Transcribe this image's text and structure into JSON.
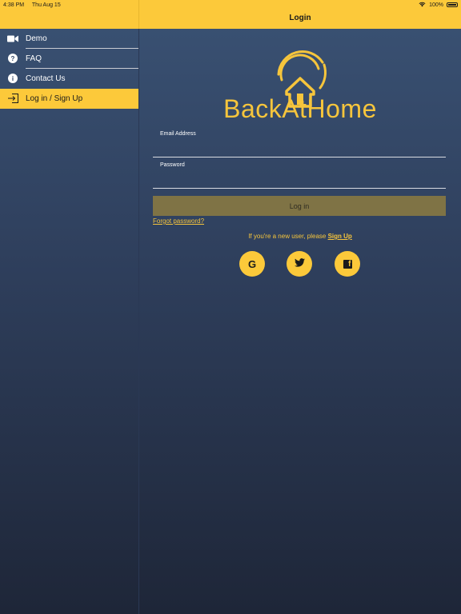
{
  "status_bar": {
    "time": "4:38 PM",
    "date": "Thu Aug 15",
    "battery": "100%",
    "wifi_icon": "wifi-icon",
    "battery_icon": "battery-icon"
  },
  "header": {
    "title": "Login"
  },
  "sidebar": {
    "items": [
      {
        "label": "Demo",
        "icon": "video-camera-icon"
      },
      {
        "label": "FAQ",
        "icon": "question-circle-icon",
        "glyph": "?"
      },
      {
        "label": "Contact Us",
        "icon": "info-circle-icon",
        "glyph": "i"
      },
      {
        "label": "Log in / Sign Up",
        "icon": "login-arrow-icon",
        "active": true
      }
    ]
  },
  "brand": {
    "name": "BackAtHome",
    "logo_icon": "home-signal-logo"
  },
  "form": {
    "email_label": "Email Address",
    "email_value": "",
    "password_label": "Password",
    "password_value": "",
    "login_label": "Log in",
    "forgot_label": "Forgot password?"
  },
  "signup": {
    "prompt": "If you're a new user, please ",
    "link": "Sign Up"
  },
  "social": [
    {
      "icon": "google-icon",
      "glyph": "G"
    },
    {
      "icon": "twitter-icon"
    },
    {
      "icon": "facebook-icon",
      "glyph": "f"
    }
  ],
  "colors": {
    "accent": "#fcc93a",
    "logo": "#f6c53c",
    "button_disabled": "#7f7345",
    "background_top": "#3a5274",
    "background_bottom": "#1e2638"
  }
}
